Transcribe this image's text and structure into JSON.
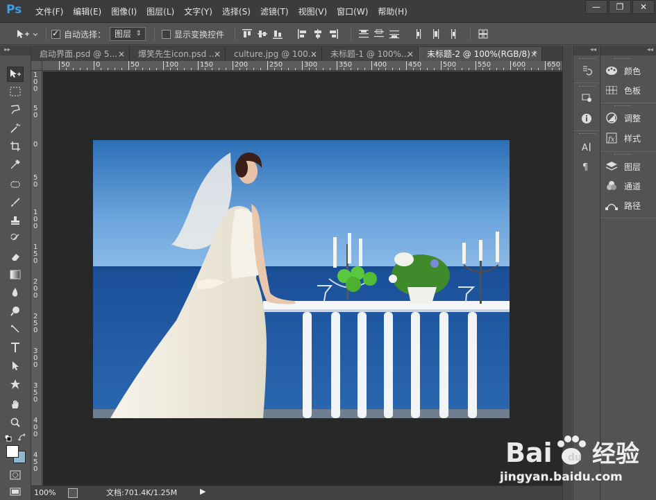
{
  "app": {
    "logo": "Ps"
  },
  "menu": [
    "文件(F)",
    "编辑(E)",
    "图像(I)",
    "图层(L)",
    "文字(Y)",
    "选择(S)",
    "滤镜(T)",
    "视图(V)",
    "窗口(W)",
    "帮助(H)"
  ],
  "window_controls": {
    "minimize": "—",
    "restore": "❐",
    "close": "✕"
  },
  "options": {
    "auto_select_label": "自动选择：",
    "auto_select_checked": true,
    "auto_select_target": "图层",
    "show_transform_label": "显示变换控件",
    "show_transform_checked": false
  },
  "tabs": [
    {
      "label": "启动界面.psd @ 5...",
      "close": "×",
      "active": false
    },
    {
      "label": "爆笑先生icon.psd ...",
      "close": "×",
      "active": false
    },
    {
      "label": "culture.jpg @ 100...",
      "close": "×",
      "active": false
    },
    {
      "label": "未标题-1 @ 100%...",
      "close": "×",
      "active": false
    },
    {
      "label": "未标题-2 @ 100%(RGB/8) *",
      "close": "×",
      "active": true
    }
  ],
  "ruler_top": [
    "50",
    "0",
    "50",
    "100",
    "150",
    "200",
    "250",
    "300",
    "350",
    "400",
    "450",
    "500",
    "550",
    "600",
    "650"
  ],
  "ruler_left": [
    "100",
    "50",
    "0",
    "50",
    "100",
    "150",
    "200",
    "250",
    "300",
    "350",
    "400",
    "450"
  ],
  "status": {
    "zoom": "100%",
    "doc_info": "文档:701.4K/1.25M",
    "arrow": "▶"
  },
  "panels": {
    "color": "颜色",
    "swatches": "色板",
    "adjustments": "调整",
    "styles": "样式",
    "layers": "图层",
    "channels": "通道",
    "paths": "路径"
  },
  "watermark": {
    "brand": "Bai 经验",
    "url": "jingyan.baidu.com"
  },
  "colors": {
    "ps_blue": "#38a0e6",
    "bg_color_swatch": "#8fb8cc",
    "fg_color_swatch": "#ffffff"
  }
}
